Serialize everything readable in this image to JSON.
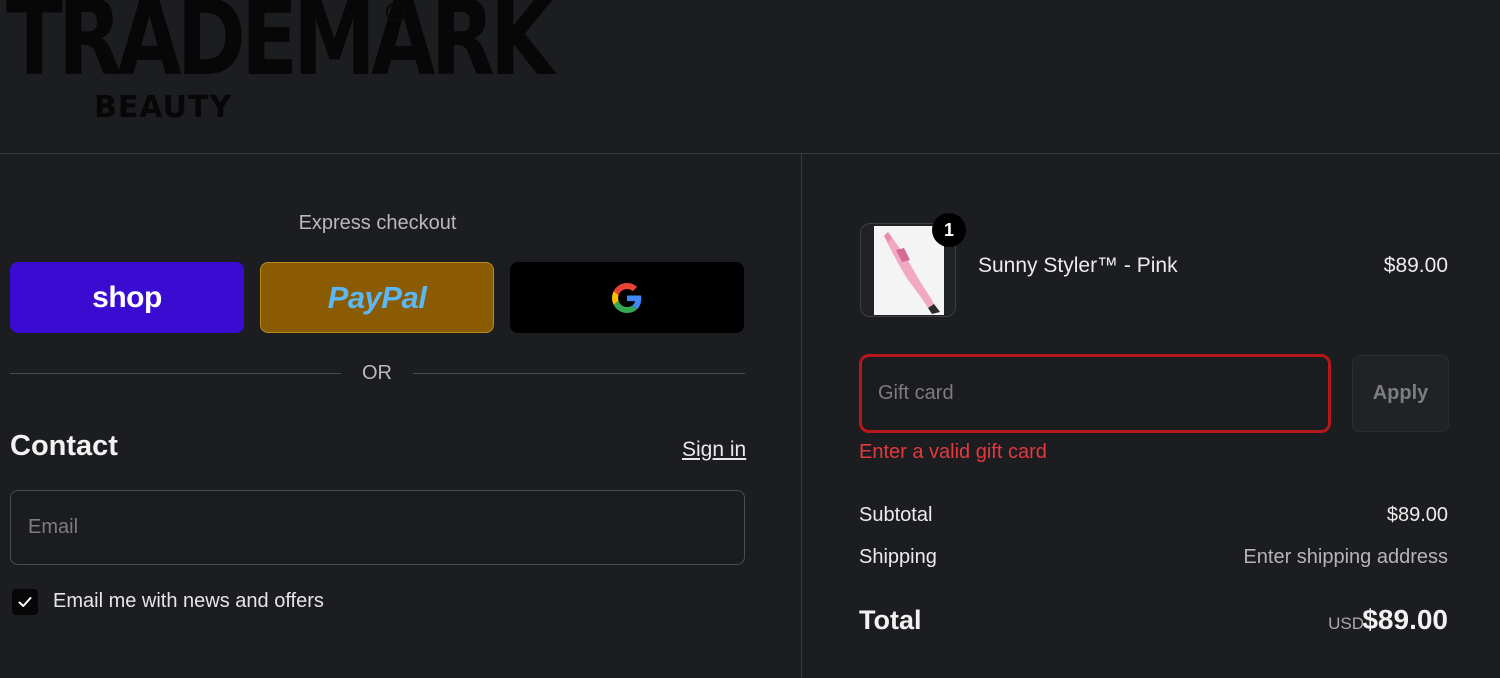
{
  "brand": {
    "logo_main": "TRADEMARK",
    "logo_sub": "BEAUTY",
    "logo_mark": "R"
  },
  "express": {
    "title": "Express checkout",
    "shop_label": "shop",
    "paypal_label": "PayPal",
    "gpay_icon": "google-g-icon",
    "separator": "OR"
  },
  "contact": {
    "title": "Contact",
    "sign_in": "Sign in",
    "email_placeholder": "Email",
    "newsletter_label": "Email me with news and offers",
    "newsletter_checked": true
  },
  "cart": {
    "item": {
      "name": "Sunny Styler™ - Pink",
      "price": "$89.00",
      "quantity": "1"
    },
    "gift_card": {
      "placeholder": "Gift card",
      "apply_label": "Apply",
      "error": "Enter a valid gift card"
    },
    "summary": {
      "subtotal_label": "Subtotal",
      "subtotal_value": "$89.00",
      "shipping_label": "Shipping",
      "shipping_value": "Enter shipping address",
      "total_label": "Total",
      "currency": "USD",
      "total_value": "$89.00"
    }
  },
  "colors": {
    "background": "#1c1d20",
    "shop_pay": "#3a0bd0",
    "paypal": "#8a5b00",
    "error": "#e23a3e"
  }
}
